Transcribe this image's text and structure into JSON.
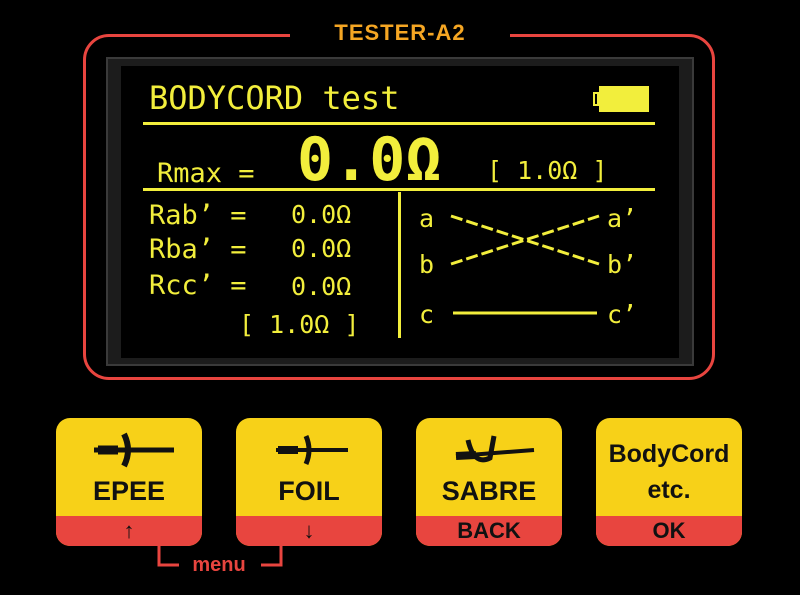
{
  "device": {
    "title": "TESTER-A2",
    "accent_color": "#e8453f",
    "lcd_color": "#f2ee3c",
    "button_color": "#f7d118"
  },
  "screen": {
    "heading": "BODYCORD test",
    "battery_icon": "battery-full-icon",
    "rmax_label": "Rmax =",
    "rmax_value": "0.0Ω",
    "rmax_limit": "[ 1.0Ω ]",
    "readings": [
      {
        "label": "Rab’ =",
        "value": "0.0Ω"
      },
      {
        "label": "Rba’ =",
        "value": "0.0Ω"
      },
      {
        "label": "Rcc’ =",
        "value": "0.0Ω"
      }
    ],
    "readings_limit": "[ 1.0Ω ]",
    "wiring": {
      "left": [
        "a",
        "b",
        "c"
      ],
      "right": [
        "a’",
        "b’",
        "c’"
      ]
    }
  },
  "buttons": [
    {
      "label": "EPEE",
      "sub": "↑",
      "icon": "epee-icon"
    },
    {
      "label": "FOIL",
      "sub": "↓",
      "icon": "foil-icon"
    },
    {
      "label": "SABRE",
      "sub": "BACK",
      "icon": "sabre-icon"
    },
    {
      "label_line1": "BodyCord",
      "label_line2": "etc.",
      "sub": "OK"
    }
  ],
  "menu_label": "menu"
}
